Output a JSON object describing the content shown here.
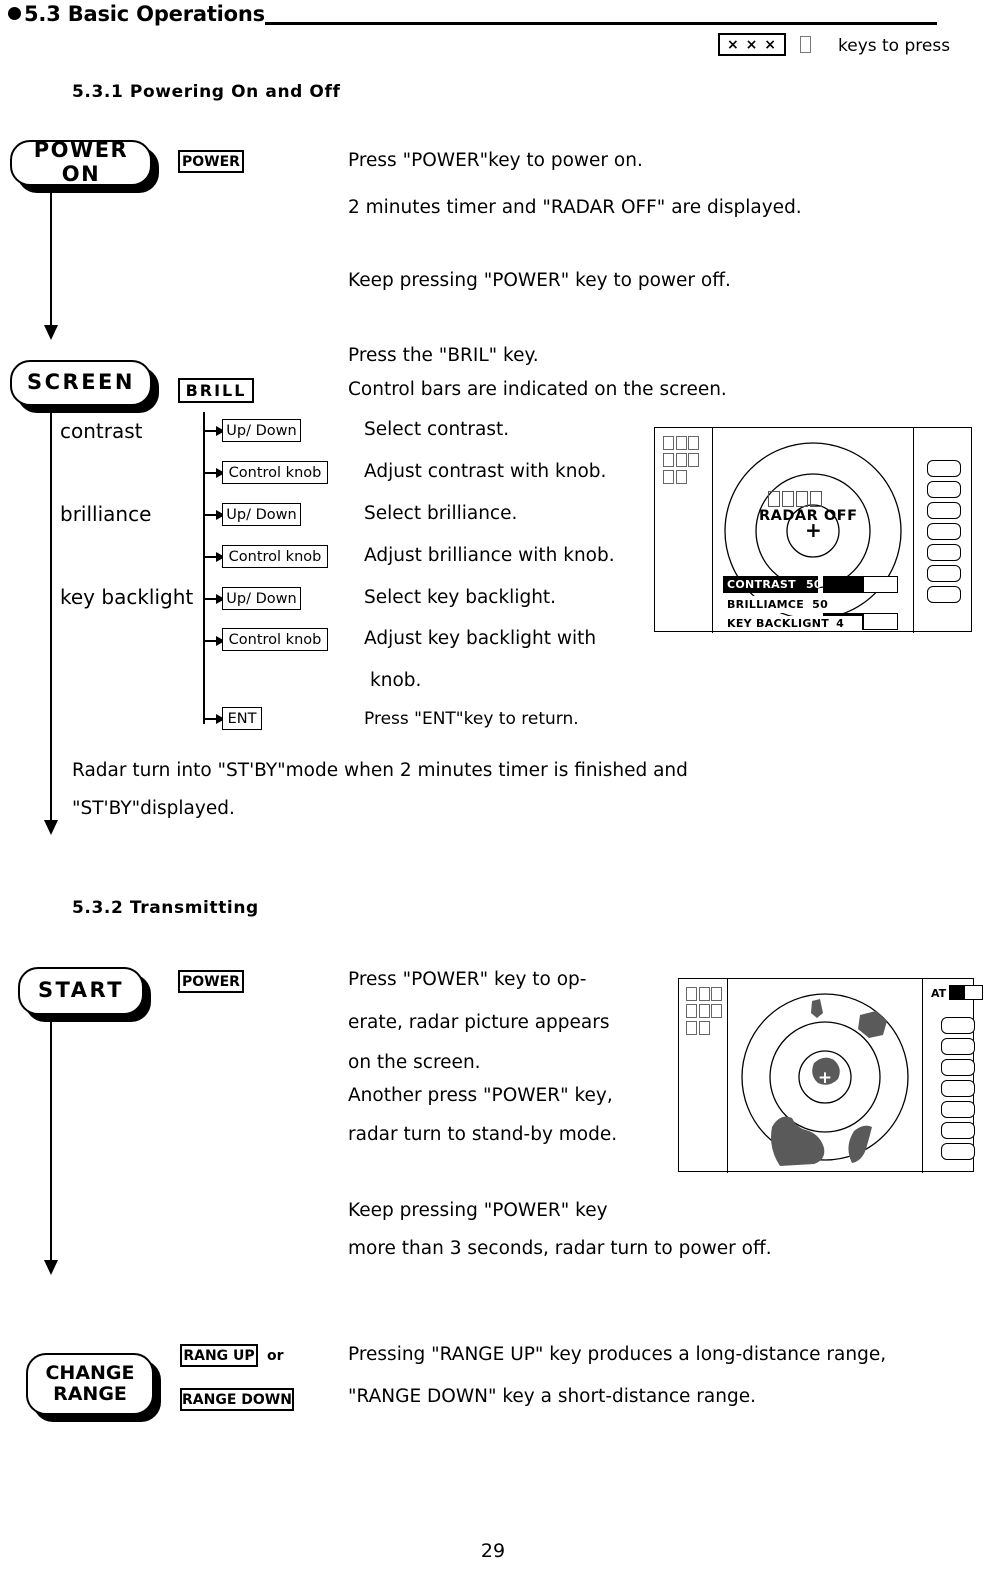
{
  "header": {
    "bullet": "●",
    "section_number": "5.3",
    "section_title": "Basic Operations",
    "legend_key_sample": "× × ×",
    "legend_text": "keys to press"
  },
  "sections": {
    "s531": "5.3.1 Powering On and Off",
    "s532": "5.3.2 Transmitting"
  },
  "flow": {
    "power_on": "POWER ON",
    "screen": "SCREEN",
    "start": "START",
    "change_range_line1": "CHANGE",
    "change_range_line2": "RANGE"
  },
  "keys": {
    "power": "POWER",
    "brill": "BRILL",
    "ent": "ENT",
    "updown": "Up/ Down",
    "control_knob": "Control knob",
    "range_up": "RANG UP",
    "range_down": "RANGE DOWN",
    "or": "or"
  },
  "labels": {
    "contrast": "contrast",
    "brilliance": "brilliance",
    "key_backlight": "key backlight"
  },
  "text": {
    "power_on_1": "Press \"POWER\"key to power on.",
    "power_on_2": "2 minutes timer and \"RADAR OFF\" are displayed.",
    "power_off_1": "Keep pressing \"POWER\" key to power off.",
    "bril_1": "Press the \"BRIL\" key.",
    "bril_2": "Control bars are indicated on the screen.",
    "select_contrast": "Select contrast.",
    "adjust_contrast": "Adjust contrast with knob.",
    "select_brilliance": "Select brilliance.",
    "adjust_brilliance": "Adjust brilliance with knob.",
    "select_key_backlight": "Select key backlight.",
    "adjust_key_backlight_1": "Adjust key backlight with",
    "adjust_key_backlight_2": "knob.",
    "press_ent": "Press \"ENT\"key to return.",
    "stby_1": "Radar turn into \"ST'BY\"mode when 2 minutes timer is finished and",
    "stby_2": "\"ST'BY\"displayed.",
    "tx_1": "Press  \"POWER\"  key  to  op-",
    "tx_2": "erate,  radar  picture  appears",
    "tx_3": "on the screen.",
    "tx_4": "Another press \"POWER\" key,",
    "tx_5": "radar turn to stand-by mode.",
    "tx_6": "Keep pressing \"POWER\" key",
    "tx_7": "more than 3 seconds, radar turn to   power off.",
    "range_1": "Pressing \"RANGE UP\" key produces a long-distance range,",
    "range_2": "\"RANGE    DOWN\" key a short-distance range."
  },
  "radar_off_display": {
    "status": "RADAR OFF",
    "bars": [
      {
        "label": "CONTRAST",
        "value": "50",
        "fill_percent": 55,
        "selected": true
      },
      {
        "label": "BRILLIAMCE",
        "value": "50",
        "fill_percent": 55,
        "selected": false
      },
      {
        "label": "KEY BACKLIGNT",
        "value": "4",
        "fill_percent": 0,
        "selected": false
      }
    ]
  },
  "radar_on_display": {
    "mode_label": "AT"
  },
  "page": {
    "number": "29"
  }
}
